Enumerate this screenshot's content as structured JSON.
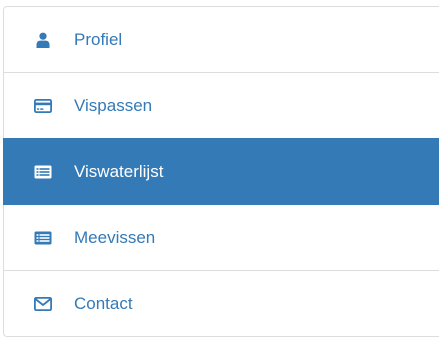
{
  "colors": {
    "accent": "#337ab7",
    "active_text": "#ffffff",
    "border": "#dddddd"
  },
  "menu": {
    "items": [
      {
        "label": "Profiel",
        "icon": "user-icon",
        "active": false
      },
      {
        "label": "Vispassen",
        "icon": "credit-card-icon",
        "active": false
      },
      {
        "label": "Viswaterlijst",
        "icon": "list-card-icon",
        "active": true
      },
      {
        "label": "Meevissen",
        "icon": "list-card-icon",
        "active": false
      },
      {
        "label": "Contact",
        "icon": "envelope-icon",
        "active": false
      }
    ]
  }
}
